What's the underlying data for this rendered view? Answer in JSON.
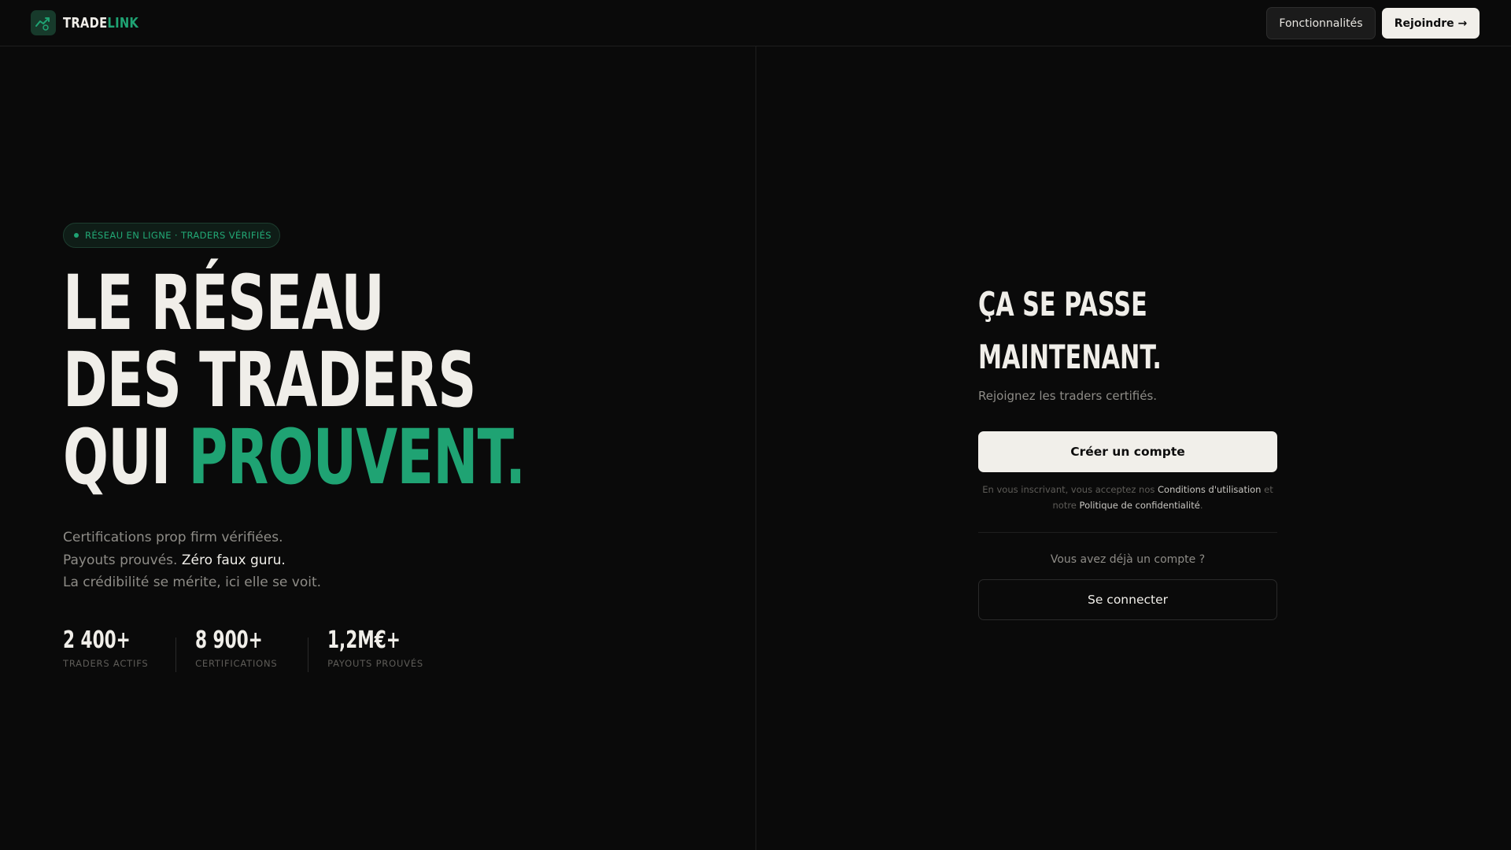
{
  "header": {
    "logo_part1": "TRADE",
    "logo_part2": "LINK",
    "logo_icon": "trending-up-icon",
    "nav_features": "Fonctionnalités",
    "nav_join": "Rejoindre →"
  },
  "hero": {
    "badge": "RÉSEAU EN LIGNE · TRADERS VÉRIFIÉS",
    "headline_line1": "LE RÉSEAU",
    "headline_line2": "DES TRADERS",
    "headline_line3_prefix": "QUI ",
    "headline_line3_accent": "PROUVENT.",
    "sub_line1": "Certifications prop firm vérifiées.",
    "sub_line2_prefix": "Payouts prouvés. ",
    "sub_line2_highlight": "Zéro faux guru.",
    "sub_line3": "La crédibilité se mérite, ici elle se voit.",
    "stats": [
      {
        "value": "2 400+",
        "label": "TRADERS ACTIFS"
      },
      {
        "value": "8 900+",
        "label": "CERTIFICATIONS"
      },
      {
        "value": "1,2M€+",
        "label": "PAYOUTS PROUVÉS"
      }
    ]
  },
  "signup": {
    "title_line1": "ÇA SE PASSE",
    "title_line2": "MAINTENANT.",
    "subtitle": "Rejoignez les traders certifiés.",
    "create_button": "Créer un compte",
    "legal_prefix": "En vous inscrivant, vous acceptez nos ",
    "legal_terms": "Conditions d'utilisation",
    "legal_middle": " et notre ",
    "legal_privacy": "Politique de confidentialité",
    "legal_suffix": ".",
    "already_text": "Vous avez déjà un compte ?",
    "login_button": "Se connecter"
  },
  "colors": {
    "background": "#0a0a0a",
    "accent": "#1fa373",
    "text": "#f0eee9",
    "muted": "#8e8c87"
  }
}
